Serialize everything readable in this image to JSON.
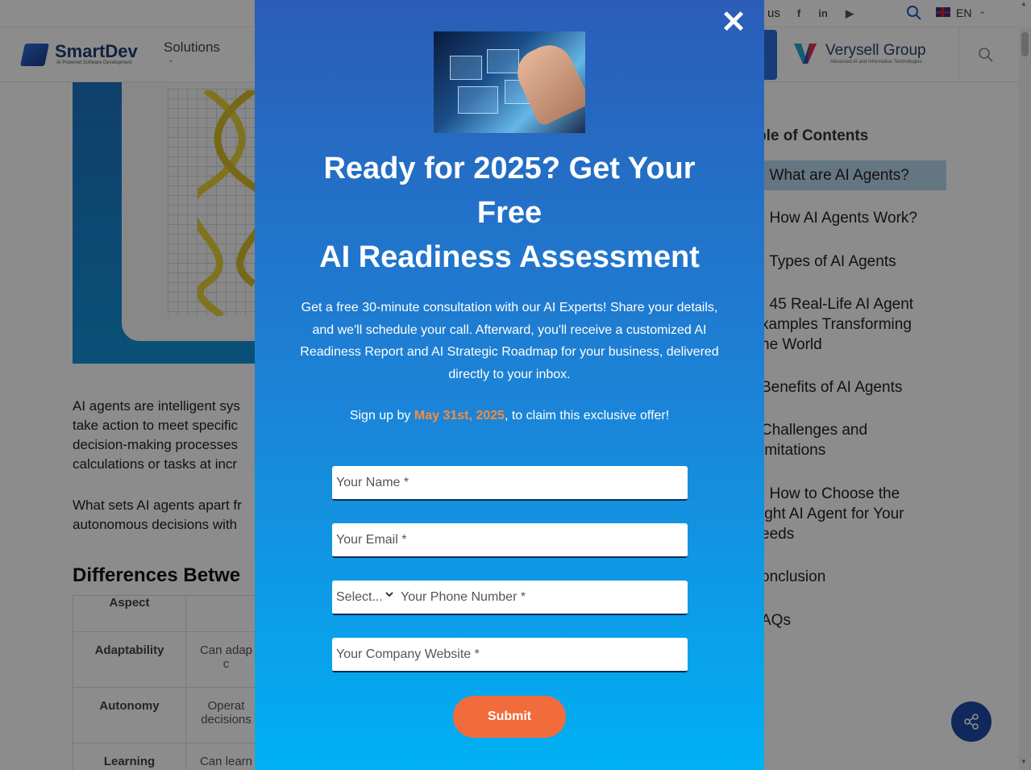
{
  "topbar": {
    "contact_label": "us",
    "social_icons": [
      "facebook-icon",
      "linkedin-icon",
      "youtube-icon"
    ],
    "language": "EN"
  },
  "header": {
    "logo_text": "SmartDev",
    "logo_sub": "AI Powered Software Development",
    "nav_solutions": "Solutions",
    "partner_name": "Verysell Group",
    "partner_sub": "Advanced AI and Information Technologies"
  },
  "article": {
    "para1": "AI agents are intelligent sys",
    "para1_l2": "take action to meet specific",
    "para1_l3": "decision-making processes",
    "para1_l4": "calculations or tasks at incr",
    "para2_l1": "What sets AI agents apart fr",
    "para2_l2": "autonomous decisions with",
    "heading": "Differences Betwe",
    "table": {
      "header": "Aspect",
      "rows": [
        {
          "aspect": "Adaptability",
          "value": "Can adap",
          "value2": "c"
        },
        {
          "aspect": "Autonomy",
          "value": "Operat",
          "value2": "decisions"
        },
        {
          "aspect": "Learning",
          "value": "Can learn",
          "value2": ""
        }
      ]
    }
  },
  "toc": {
    "title": "ble of Contents",
    "items": [
      ". What are AI Agents?",
      ". How AI Agents Work?",
      ". Types of AI Agents",
      ". 45 Real-Life AI Agent",
      "xamples Transforming",
      "he World",
      " Benefits of AI Agents",
      " Challenges and",
      "imitations",
      ". How to Choose the",
      "ight AI Agent for Your",
      "eeds",
      "onclusion",
      "AQs"
    ]
  },
  "modal": {
    "title_line1": "Ready for 2025? Get Your",
    "title_line2": "Free",
    "title_line3": "AI Readiness Assessment",
    "description": "Get a free 30-minute consultation with our AI Experts! Share your details, and we'll schedule your call. Afterward, you'll receive a customized AI Readiness Report and AI Strategic Roadmap for your business, delivered directly to your inbox.",
    "signup_prefix": "Sign up by ",
    "signup_date": "May 31st, 2025",
    "signup_suffix": ", to claim this exclusive offer!",
    "name_placeholder": "Your Name *",
    "email_placeholder": "Your Email *",
    "country_select": "Select...",
    "phone_placeholder": "Your Phone Number *",
    "website_placeholder": "Your Company Website *",
    "submit_label": "Submit",
    "close_glyph": "✕",
    "accent_color": "#f26b3a"
  }
}
